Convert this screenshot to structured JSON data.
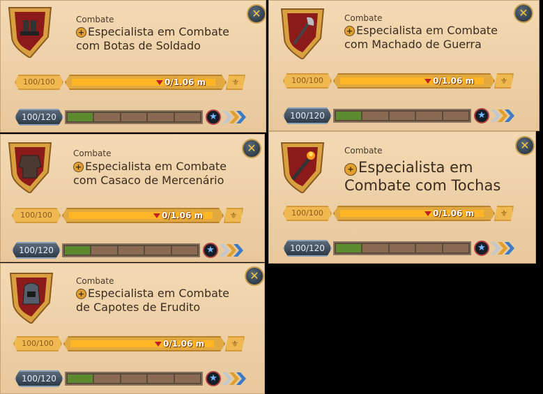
{
  "cards": [
    {
      "category": "Combate",
      "title_line1": "Especialista em Combate",
      "title_line2": "com Botas de Soldado",
      "item_icon": "soldier-boots-icon",
      "durability": "100/100",
      "currency": "0/1.06 m",
      "level": "100/120",
      "progress_segments_filled": 1,
      "progress_segments_total": 5
    },
    {
      "category": "Combate",
      "title_line1": "Especialista em Combate",
      "title_line2": "com Machado de Guerra",
      "item_icon": "war-axe-icon",
      "durability": "100/100",
      "currency": "0/1.06 m",
      "level": "100/120",
      "progress_segments_filled": 1,
      "progress_segments_total": 5
    },
    {
      "category": "Combate",
      "title_line1": "Especialista em Combate",
      "title_line2": "com Casaco de Mercenário",
      "item_icon": "mercenary-jacket-icon",
      "durability": "100/100",
      "currency": "0/1.06 m",
      "level": "100/120",
      "progress_segments_filled": 1,
      "progress_segments_total": 5
    },
    {
      "category": "Combate",
      "title_line1": "Especialista em",
      "title_line2": "Combate com Tochas",
      "item_icon": "torch-icon",
      "durability": "100/100",
      "currency": "0/1.06 m",
      "level": "100/120",
      "progress_segments_filled": 1,
      "progress_segments_total": 5
    },
    {
      "category": "Combate",
      "title_line1": "Especialista em Combate",
      "title_line2": "de Capotes de Erudito",
      "item_icon": "scholar-cowl-icon",
      "durability": "100/100",
      "currency": "0/1.06 m",
      "level": "100/120",
      "progress_segments_filled": 1,
      "progress_segments_total": 5
    }
  ],
  "colors": {
    "accent": "#ffb524",
    "progress": "#5c8a2e",
    "shield_red": "#8c1a1a",
    "shield_gold": "#d9a040"
  }
}
